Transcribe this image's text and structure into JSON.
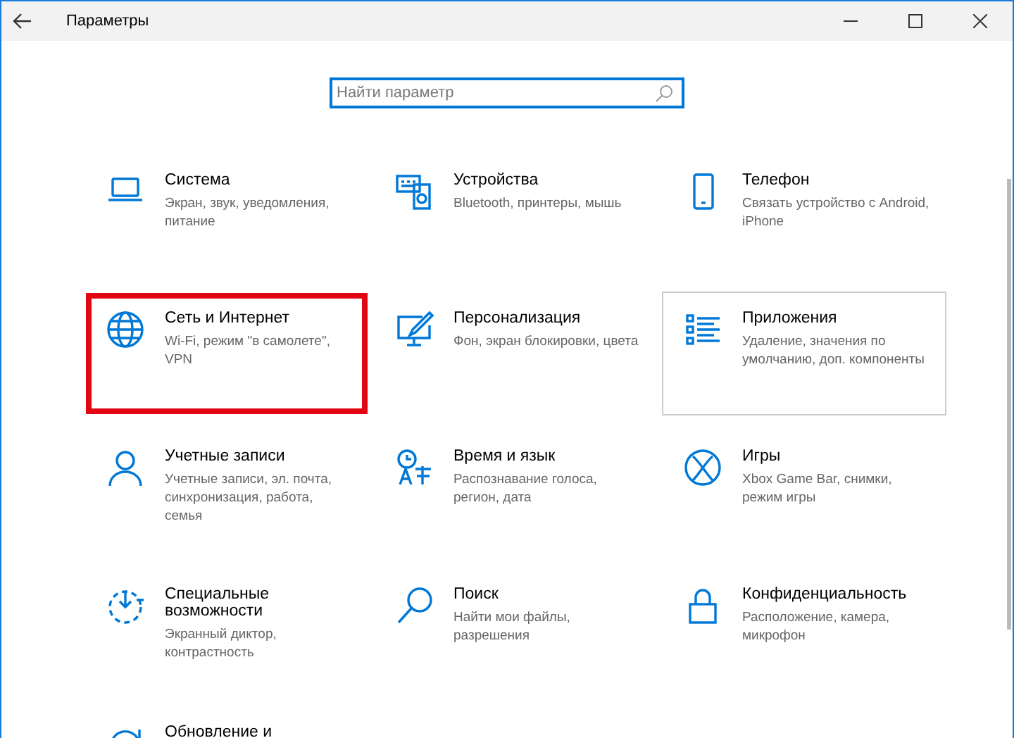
{
  "window": {
    "title": "Параметры"
  },
  "search": {
    "placeholder": "Найти параметр"
  },
  "tiles": [
    {
      "title": "Система",
      "description": "Экран, звук, уведомления, питание",
      "highlighted": false,
      "hovered": false
    },
    {
      "title": "Устройства",
      "description": "Bluetooth, принтеры, мышь",
      "highlighted": false,
      "hovered": false
    },
    {
      "title": "Телефон",
      "description": "Связать устройство с Android, iPhone",
      "highlighted": false,
      "hovered": false
    },
    {
      "title": "Сеть и Интернет",
      "description": "Wi-Fi, режим \"в самолете\", VPN",
      "highlighted": true,
      "hovered": false
    },
    {
      "title": "Персонализация",
      "description": "Фон, экран блокировки, цвета",
      "highlighted": false,
      "hovered": false
    },
    {
      "title": "Приложения",
      "description": "Удаление, значения по умолчанию, доп. компоненты",
      "highlighted": false,
      "hovered": true
    },
    {
      "title": "Учетные записи",
      "description": "Учетные записи, эл. почта, синхронизация, работа, семья",
      "highlighted": false,
      "hovered": false
    },
    {
      "title": "Время и язык",
      "description": "Распознавание голоса, регион, дата",
      "highlighted": false,
      "hovered": false
    },
    {
      "title": "Игры",
      "description": "Xbox Game Bar, снимки, режим игры",
      "highlighted": false,
      "hovered": false
    },
    {
      "title": "Специальные возможности",
      "description": "Экранный диктор, контрастность",
      "highlighted": false,
      "hovered": false
    },
    {
      "title": "Поиск",
      "description": "Найти мои файлы, разрешения",
      "highlighted": false,
      "hovered": false
    },
    {
      "title": "Конфиденциальность",
      "description": "Расположение, камера, микрофон",
      "highlighted": false,
      "hovered": false
    },
    {
      "title": "Обновление и",
      "highlighted": false,
      "hovered": false
    }
  ]
}
